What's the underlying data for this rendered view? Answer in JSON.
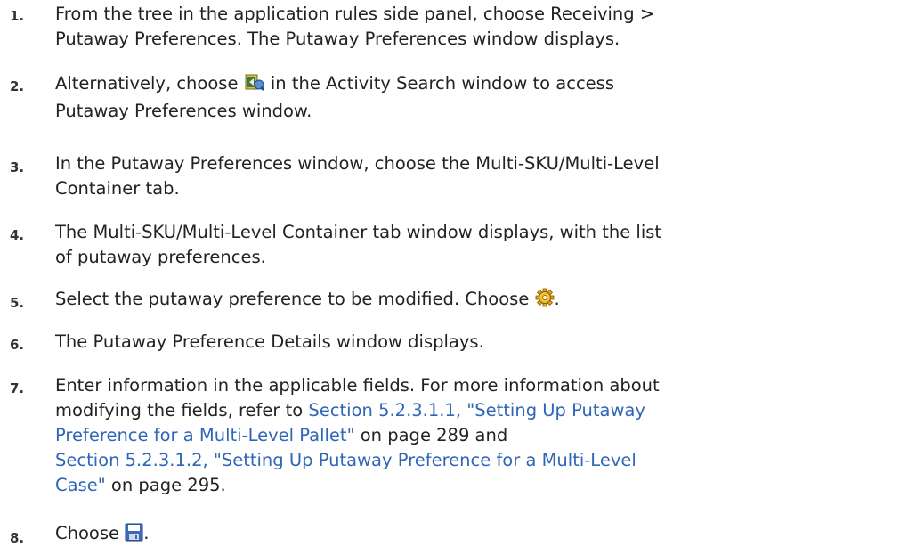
{
  "steps": [
    {
      "num": "1.",
      "lines": [
        "From the tree in the application rules side panel, choose Receiving >",
        "Putaway Preferences. The Putaway Preferences window displays."
      ]
    },
    {
      "num": "2.",
      "pre": "Alternatively, choose",
      "icon": "activity-search-putaway-icon",
      "post": " in the Activity Search window to access",
      "line2": "Putaway Preferences window."
    },
    {
      "num": "3.",
      "lines": [
        "In the Putaway Preferences window, choose the Multi-SKU/Multi-Level",
        "Container tab."
      ]
    },
    {
      "num": "4.",
      "lines": [
        "The Multi-SKU/Multi-Level Container tab window displays, with the list",
        "of putaway preferences."
      ]
    },
    {
      "num": "5.",
      "pre": "Select the putaway preference to be modified. Choose",
      "icon": "gear-icon",
      "post": "."
    },
    {
      "num": "6.",
      "text": "The Putaway Preference Details window displays."
    },
    {
      "num": "7.",
      "line1": "Enter information in the applicable fields. For more information about",
      "line2_pre": "modifying the fields, refer to ",
      "link1_a": "Section 5.2.3.1.1, \"Setting Up Putaway",
      "link1_b": "Preference for a Multi-Level Pallet\"",
      "mid": " on page 289 and",
      "link2_a": "Section 5.2.3.1.2, \"Setting Up Putaway Preference for a Multi-Level",
      "link2_b": "Case\"",
      "tail": " on page 295."
    },
    {
      "num": "8.",
      "pre": "Choose",
      "icon": "save-icon",
      "post": "."
    }
  ],
  "colors": {
    "link": "#2f66b8",
    "text": "#222222",
    "number": "#333333"
  }
}
